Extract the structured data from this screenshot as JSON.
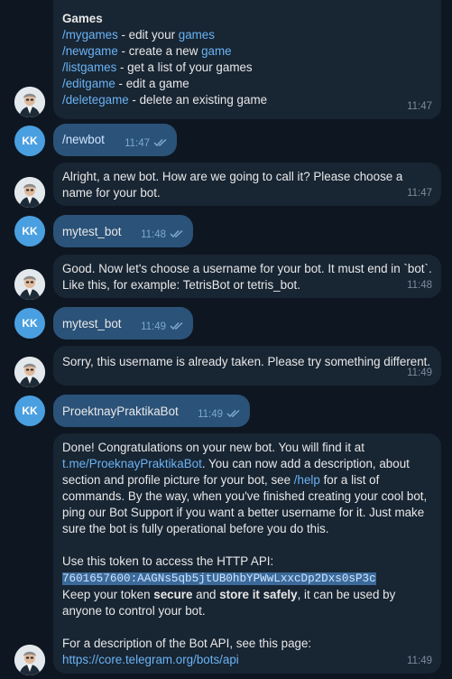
{
  "messages": {
    "games": {
      "title": "Games",
      "lines": [
        {
          "cmd": "/mygames",
          "text": " - edit your ",
          "link": "games",
          "rest": ""
        },
        {
          "cmd": "/newgame",
          "text": " - create a new ",
          "link": "game",
          "rest": ""
        },
        {
          "cmd": "/listgames",
          "text": " - get a list of your games",
          "link": "",
          "rest": ""
        },
        {
          "cmd": "/editgame",
          "text": " - edit a game",
          "link": "",
          "rest": ""
        },
        {
          "cmd": "/deletegame",
          "text": " - delete an existing game",
          "link": "",
          "rest": ""
        }
      ],
      "time": "11:47"
    },
    "m_newbot": {
      "text": "/newbot",
      "time": "11:47"
    },
    "m_choose": {
      "text": "Alright, a new bot. How are we going to call it? Please choose a name for your bot.",
      "time": "11:47"
    },
    "m_name": {
      "text": "mytest_bot",
      "time": "11:48"
    },
    "m_username": {
      "text": "Good. Now let's choose a username for your bot. It must end in `bot`. Like this, for example: TetrisBot or tetris_bot.",
      "time": "11:48"
    },
    "m_name2": {
      "text": "mytest_bot",
      "time": "11:49"
    },
    "m_taken": {
      "text": "Sorry, this username is already taken. Please try something different.",
      "time": "11:49"
    },
    "m_proekt": {
      "text": "ProektnayPraktikaBot",
      "time": "11:49"
    },
    "m_done": {
      "p1a": "Done! Congratulations on your new bot. You will find it at ",
      "p1link": "t.me/ProeknayPraktikaBot",
      "p1b": ". You can now add a description, about section and profile picture for your bot, see ",
      "p1help": "/help",
      "p1c": " for a list of commands. By the way, when you've finished creating your cool bot, ping our Bot Support if you want a better username for it. Just make sure the bot is fully operational before you do this.",
      "p2": "Use this token to access the HTTP API:",
      "token": "7601657600:AAGNs5qb5jtUB0hbYPWwLxxcDp2Dxs0sP3c",
      "p3a": "Keep your token ",
      "p3b1": "secure",
      "p3c": " and ",
      "p3b2": "store it safely",
      "p3d": ", it can be used by anyone to control your bot.",
      "p4": "For a description of the Bot API, see this page:",
      "p4link": "https://core.telegram.org/bots/api",
      "time": "11:49"
    }
  },
  "avatars": {
    "user_initials": "KK"
  }
}
